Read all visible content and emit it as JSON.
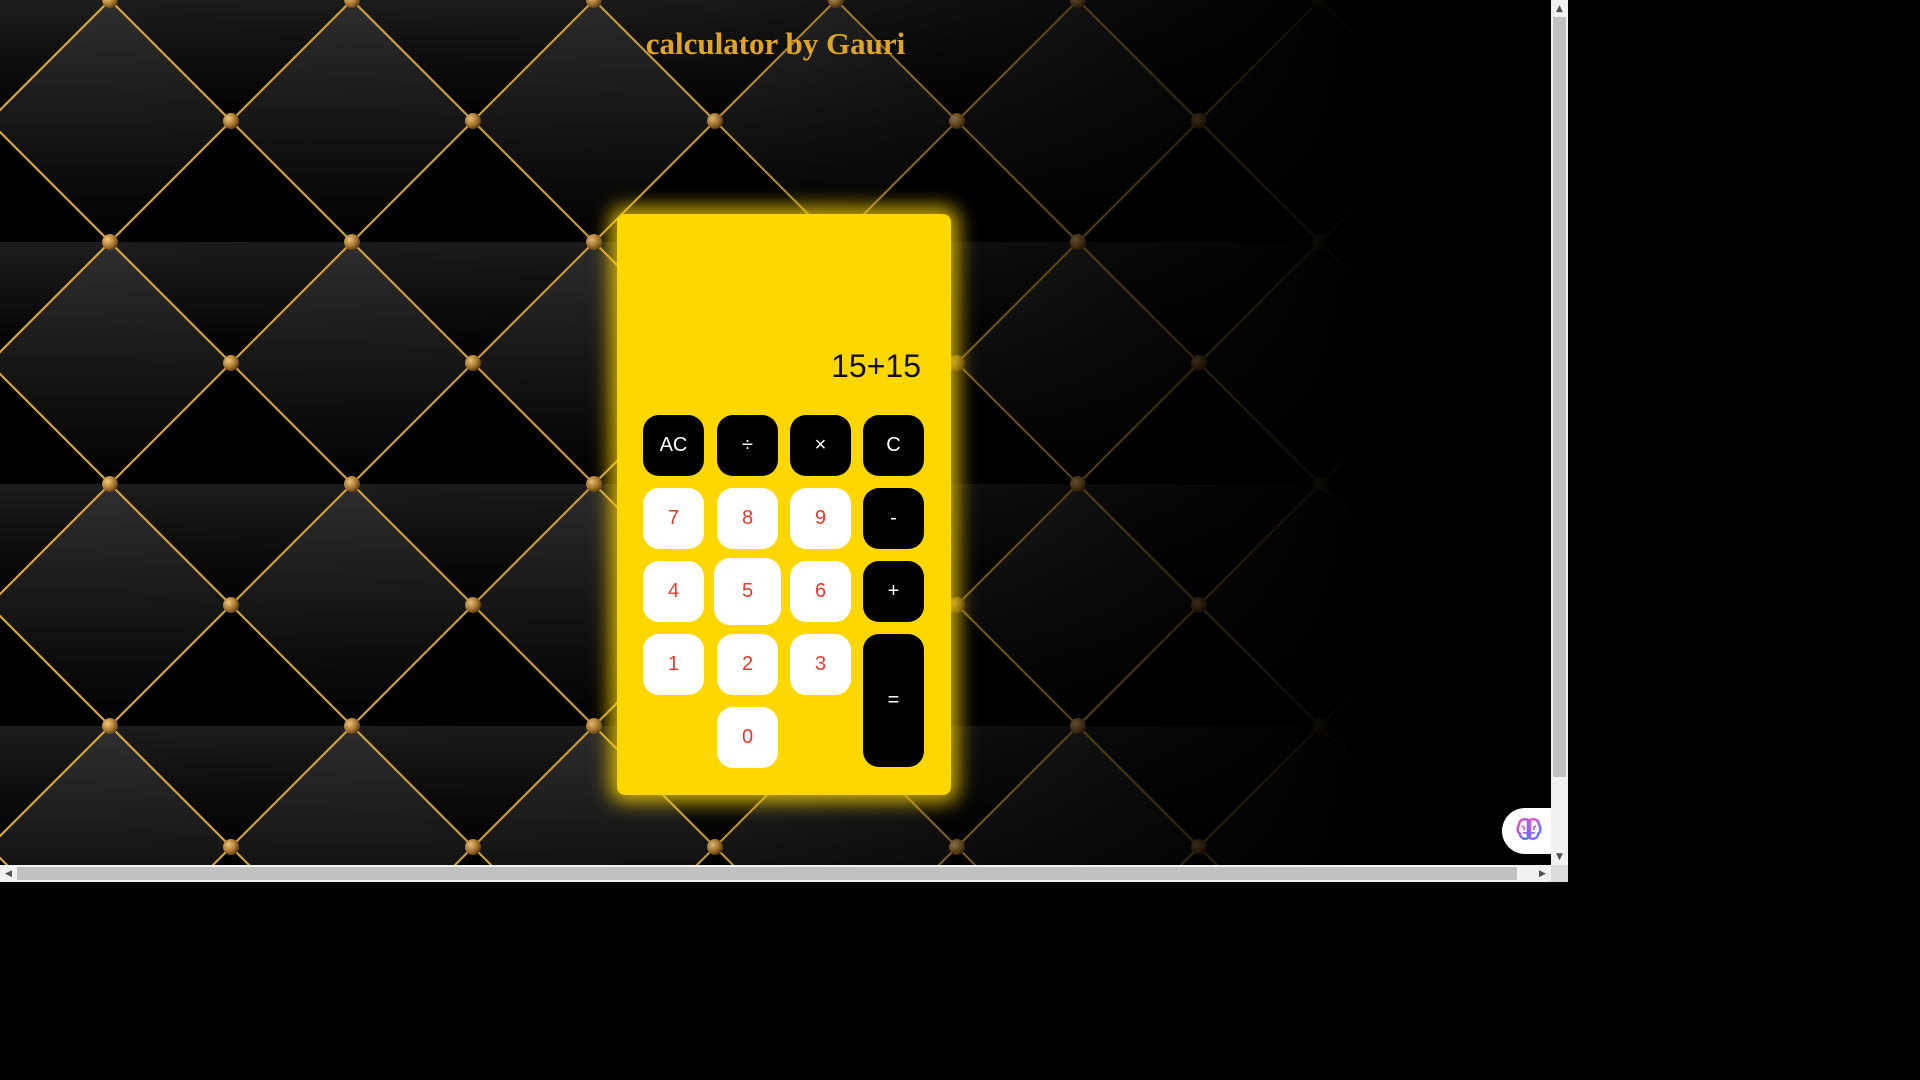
{
  "page": {
    "title": "calculator by Gauri"
  },
  "calculator": {
    "display": "15+15",
    "keys": {
      "ac": "AC",
      "divide": "÷",
      "multiply": "×",
      "clear": "C",
      "seven": "7",
      "eight": "8",
      "nine": "9",
      "minus": "-",
      "four": "4",
      "five": "5",
      "six": "6",
      "plus": "+",
      "one": "1",
      "two": "2",
      "three": "3",
      "equals": "=",
      "zero": "0"
    }
  },
  "colors": {
    "calculator_body": "#ffd700",
    "title_gold": "#e0a526",
    "digit_text": "#e4392b",
    "operator_key": "#000000"
  },
  "icons": {
    "extension": "brain-icon",
    "scroll_up": "arrow-up-icon",
    "scroll_down": "arrow-down-icon",
    "scroll_left": "arrow-left-icon",
    "scroll_right": "arrow-right-icon"
  }
}
